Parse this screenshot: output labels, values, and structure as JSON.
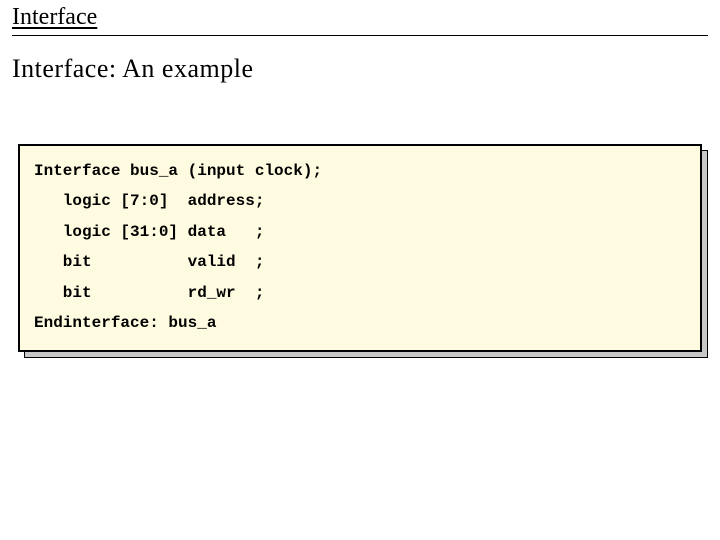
{
  "header": "Interface",
  "title": "Interface: An example",
  "code": {
    "l1": "Interface bus_a (input clock);",
    "l2": "   logic [7:0]  address;",
    "l3": "   logic [31:0] data   ;",
    "l4": "   bit          valid  ;",
    "l5": "   bit          rd_wr  ;",
    "l6": "Endinterface: bus_a"
  }
}
